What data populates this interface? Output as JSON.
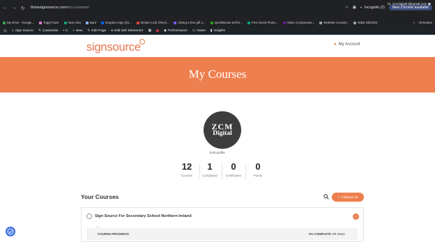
{
  "browser": {
    "url_host": "thisissignsource.com",
    "url_path": "/my-courses/",
    "incognito_label": "Incognito (2)",
    "new_chrome_label": "New Chrome available",
    "bookmarks": [
      {
        "label": "My Drive - Google...",
        "color": "#34a853"
      },
      {
        "label": "Toggl Track",
        "color": "#e57cd8"
      },
      {
        "label": "New chat",
        "color": "#10a37f"
      },
      {
        "label": "Bard",
        "color": "#8ab4f8"
      },
      {
        "label": "Dropbox Sign (for...",
        "color": "#0061fe"
      },
      {
        "label": "Broken Link Check...",
        "color": "#ea4335"
      },
      {
        "label": "Giving a free gift o...",
        "color": "#7b5cff"
      },
      {
        "label": "QuickBooks Self-E...",
        "color": "#2ca01c"
      },
      {
        "label": "Free Stock Photo...",
        "color": "#05a081"
      },
      {
        "label": "Video Compressor...",
        "color": "#6a1b9a"
      },
      {
        "label": "WebMet Consult...",
        "color": "#9aa0a6"
      },
      {
        "label": "WEB DESIGN",
        "color": "#9aa0a6"
      }
    ],
    "all_bookmarks_label": "All Bookm"
  },
  "admin_bar": {
    "site_name": "Sign Source",
    "customise": "Customise",
    "comments_count": "0",
    "new": "New",
    "edit_page": "Edit Page",
    "edit_elementor": "Edit with Elementor",
    "performance": "Performance",
    "notes": "Notes",
    "insights": "Insights",
    "greeting": "Hi, zcmdigitalni@gmail.com"
  },
  "header": {
    "logo_text": "signsource",
    "account_label": "My Account"
  },
  "banner": {
    "title": "My Courses"
  },
  "profile": {
    "avatar_line1": "ZCM",
    "avatar_line2": "Digital",
    "edit_label": "Edit profile"
  },
  "stats": [
    {
      "value": "12",
      "label": "Courses"
    },
    {
      "value": "1",
      "label": "Completed"
    },
    {
      "value": "0",
      "label": "Certificates"
    },
    {
      "value": "0",
      "label": "Points"
    }
  ],
  "courses": {
    "heading": "Your Courses",
    "collapse_label": "Collapse All",
    "items": [
      {
        "name": "Sign Source For Secondary School Northern Ireland",
        "progress_label": "COURSE PROGRESS",
        "progress_percent": "0% COMPLETE",
        "steps": "0/8 Steps"
      }
    ]
  },
  "colors": {
    "brand": "#ee7f4f",
    "chrome_dark": "#202124",
    "admin_bar": "#1d2327"
  }
}
